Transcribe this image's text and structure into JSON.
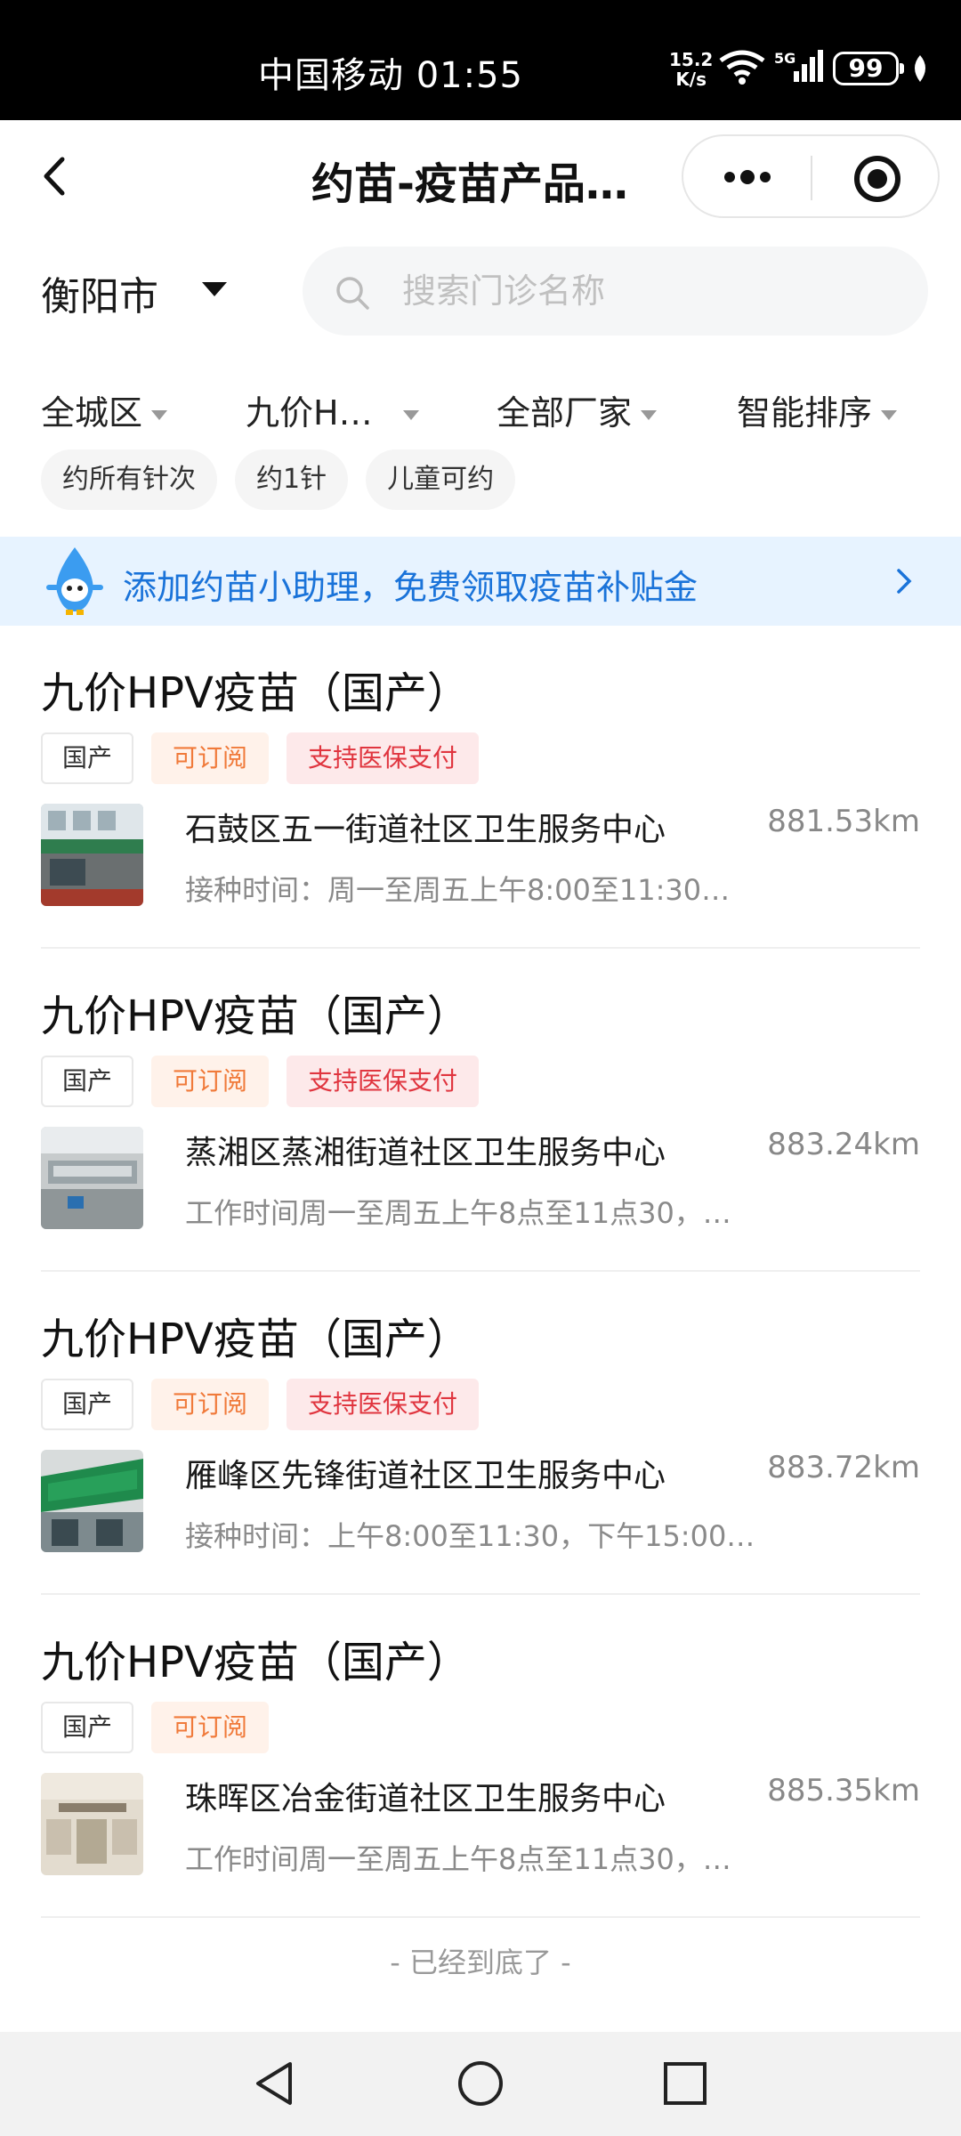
{
  "status_bar": {
    "carrier_time": "中国移动 01:55",
    "rate_value": "15.2",
    "rate_unit": "K/s",
    "network": "5G",
    "battery": "99"
  },
  "nav": {
    "title": "约苗-疫苗产品…",
    "back_icon": "back-icon",
    "more_icon": "more-icon",
    "close_icon": "target-icon"
  },
  "city": {
    "label": "衡阳市"
  },
  "search": {
    "placeholder": "搜索门诊名称",
    "value": ""
  },
  "filters": [
    "全城区",
    "九价H…",
    "全部厂家",
    "智能排序"
  ],
  "chips": [
    "约所有针次",
    "约1针",
    "儿童可约"
  ],
  "banner": {
    "text": "添加约苗小助理，免费领取疫苗补贴金"
  },
  "items": [
    {
      "title": "九价HPV疫苗（国产）",
      "tags": [
        "国产",
        "可订阅",
        "支持医保支付"
      ],
      "clinic": "石鼓区五一街道社区卫生服务中心",
      "distance": "881.53km",
      "hours": "接种时间：周一至周五上午8:00至11:30…"
    },
    {
      "title": "九价HPV疫苗（国产）",
      "tags": [
        "国产",
        "可订阅",
        "支持医保支付"
      ],
      "clinic": "蒸湘区蒸湘街道社区卫生服务中心",
      "distance": "883.24km",
      "hours": "工作时间周一至周五上午8点至11点30，…"
    },
    {
      "title": "九价HPV疫苗（国产）",
      "tags": [
        "国产",
        "可订阅",
        "支持医保支付"
      ],
      "clinic": "雁峰区先锋街道社区卫生服务中心",
      "distance": "883.72km",
      "hours": "接种时间：上午8:00至11:30，下午15:00…"
    },
    {
      "title": "九价HPV疫苗（国产）",
      "tags": [
        "国产",
        "可订阅"
      ],
      "clinic": "珠晖区冶金街道社区卫生服务中心",
      "distance": "885.35km",
      "hours": "工作时间周一至周五上午8点至11点30，…"
    }
  ],
  "footer": {
    "end_text": "- 已经到底了 -"
  },
  "colors": {
    "accent_blue": "#1a73d9",
    "banner_bg": "#e7f3ff",
    "tag_orange": "#f07a3a",
    "tag_red": "#e0353f"
  }
}
